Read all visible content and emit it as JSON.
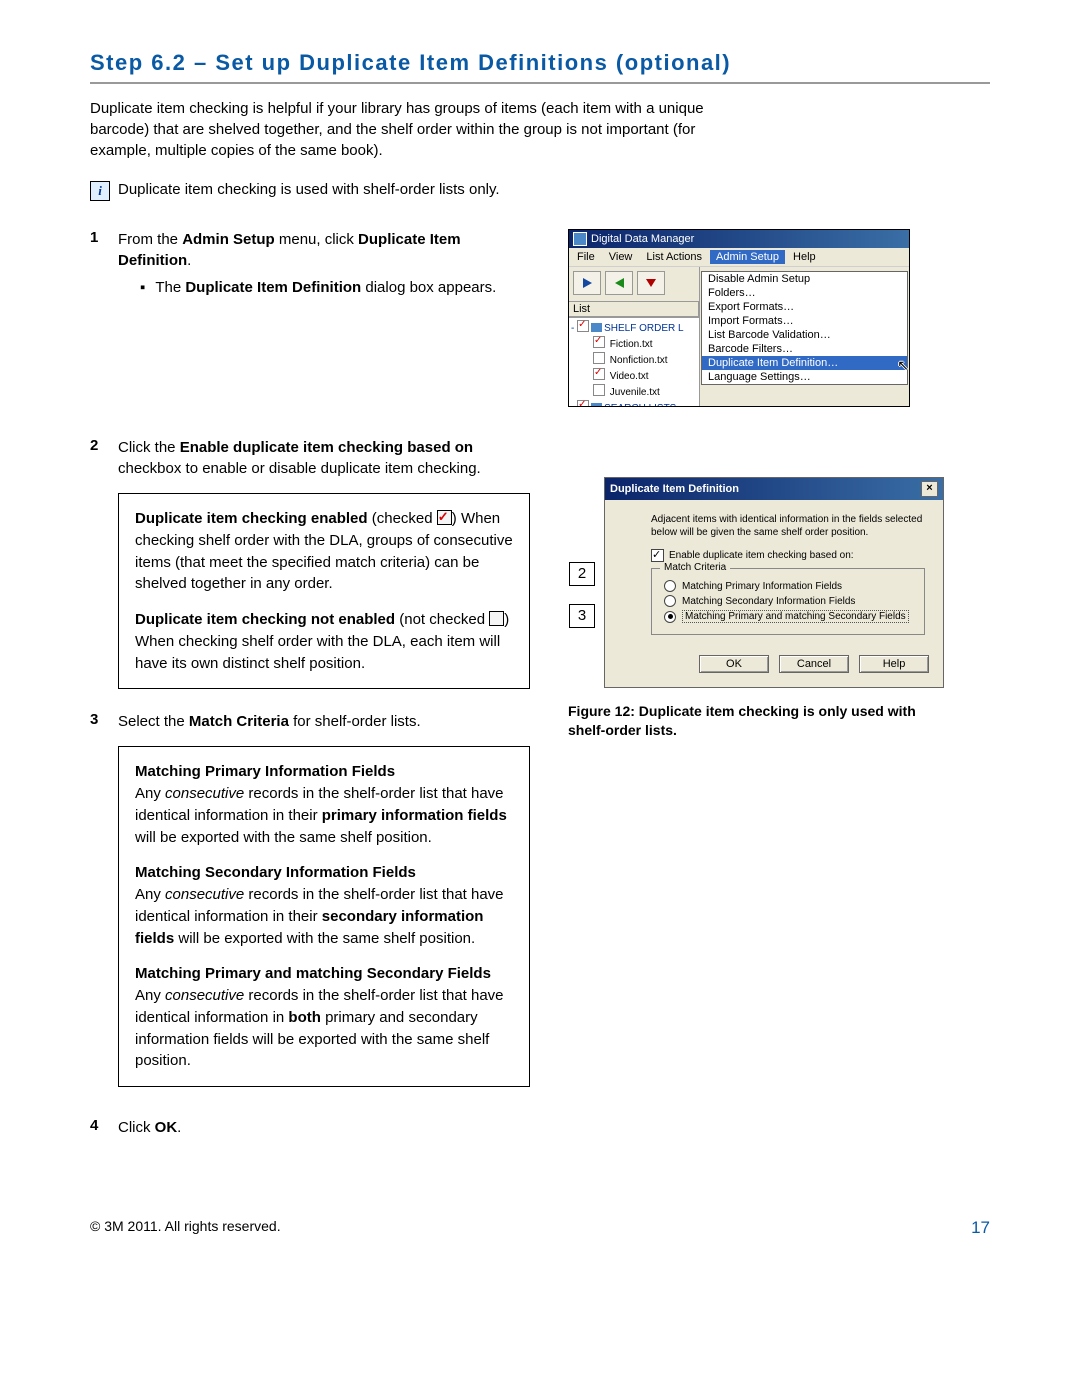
{
  "title": "Step 6.2 – Set up Duplicate Item Definitions (optional)",
  "intro": "Duplicate item checking is helpful if your library has groups of items (each item with a unique barcode) that are shelved together, and the shelf order within the group is not important (for example, multiple copies of the same book).",
  "info_note": "Duplicate item checking is used with shelf-order lists only.",
  "step1": {
    "num": "1",
    "text_a": "From the ",
    "bold_a": "Admin Setup",
    "text_b": " menu, click ",
    "bold_b": "Duplicate Item Definition",
    "text_c": ".",
    "bullet_pre": "The ",
    "bullet_bold": "Duplicate Item Definition",
    "bullet_post": " dialog box appears."
  },
  "fig1": {
    "window_title": "Digital Data Manager",
    "menus": [
      "File",
      "View",
      "List Actions",
      "Admin Setup",
      "Help"
    ],
    "list_header": "List",
    "tree_root": "SHELF ORDER L",
    "tree_items": [
      {
        "label": "Fiction.txt",
        "checked": true
      },
      {
        "label": "Nonfiction.txt",
        "checked": false
      },
      {
        "label": "Video.txt",
        "checked": true
      },
      {
        "label": "Juvenile.txt",
        "checked": false
      }
    ],
    "tree_search": "SEARCH LISTS",
    "dropdown": [
      "Disable Admin Setup",
      "Folders…",
      "Export Formats…",
      "Import Formats…",
      "List Barcode Validation…",
      "Barcode Filters…",
      "Duplicate Item Definition…",
      "Language Settings…"
    ],
    "dropdown_selected_index": 6
  },
  "step2": {
    "num": "2",
    "text_a": "Click the ",
    "bold_a": "Enable duplicate item checking based on",
    "text_b": " checkbox to enable or disable duplicate item checking."
  },
  "box1": {
    "para1_bold": "Duplicate item checking enabled",
    "para1_a": " (checked ",
    "para1_b": ") When checking shelf order with the DLA, groups of consecutive items (that meet the specified match criteria) can be shelved together in any order.",
    "para2_bold": "Duplicate item checking not enabled",
    "para2_a": " (not checked ",
    "para2_b": ") When checking shelf order with the DLA, each item will have its own distinct shelf position."
  },
  "fig2": {
    "title": "Duplicate Item Definition",
    "desc": "Adjacent items with identical information in the fields selected below will be given the same shelf order position.",
    "enable_label": "Enable duplicate item checking based on:",
    "fieldset_legend": "Match Criteria",
    "radios": [
      {
        "label": "Matching Primary Information Fields",
        "on": false,
        "boxed": false
      },
      {
        "label": "Matching Secondary Information Fields",
        "on": false,
        "boxed": false
      },
      {
        "label": "Matching Primary and matching Secondary Fields",
        "on": true,
        "boxed": true
      }
    ],
    "buttons": [
      "OK",
      "Cancel",
      "Help"
    ],
    "callout2": "2",
    "callout3": "3",
    "caption": "Figure 12: Duplicate item checking is only used with shelf-order lists."
  },
  "step3": {
    "num": "3",
    "text_a": "Select the ",
    "bold_a": "Match Criteria",
    "text_b": " for shelf-order lists."
  },
  "box2": {
    "h1": "Matching Primary Information Fields",
    "p1_a": "Any ",
    "p1_i": "consecutive",
    "p1_b": " records in the shelf-order list that have identical information in their ",
    "p1_bold": "primary information fields",
    "p1_c": " will be exported with the same shelf position.",
    "h2": "Matching Secondary Information Fields",
    "p2_a": "Any ",
    "p2_i": "consecutive",
    "p2_b": " records in the shelf-order list that have identical information in their ",
    "p2_bold": "secondary information fields",
    "p2_c": " will be exported with the same shelf position.",
    "h3": "Matching Primary and matching Secondary Fields",
    "p3_a": "Any ",
    "p3_i": "consecutive",
    "p3_b": " records in the shelf-order list that have identical information in ",
    "p3_bold": "both",
    "p3_c": " primary and secondary information fields will be exported with the same shelf position."
  },
  "step4": {
    "num": "4",
    "text_a": "Click ",
    "bold_a": "OK",
    "text_b": "."
  },
  "footer": {
    "copyright": "© 3M 2011. All rights reserved.",
    "page": "17"
  }
}
